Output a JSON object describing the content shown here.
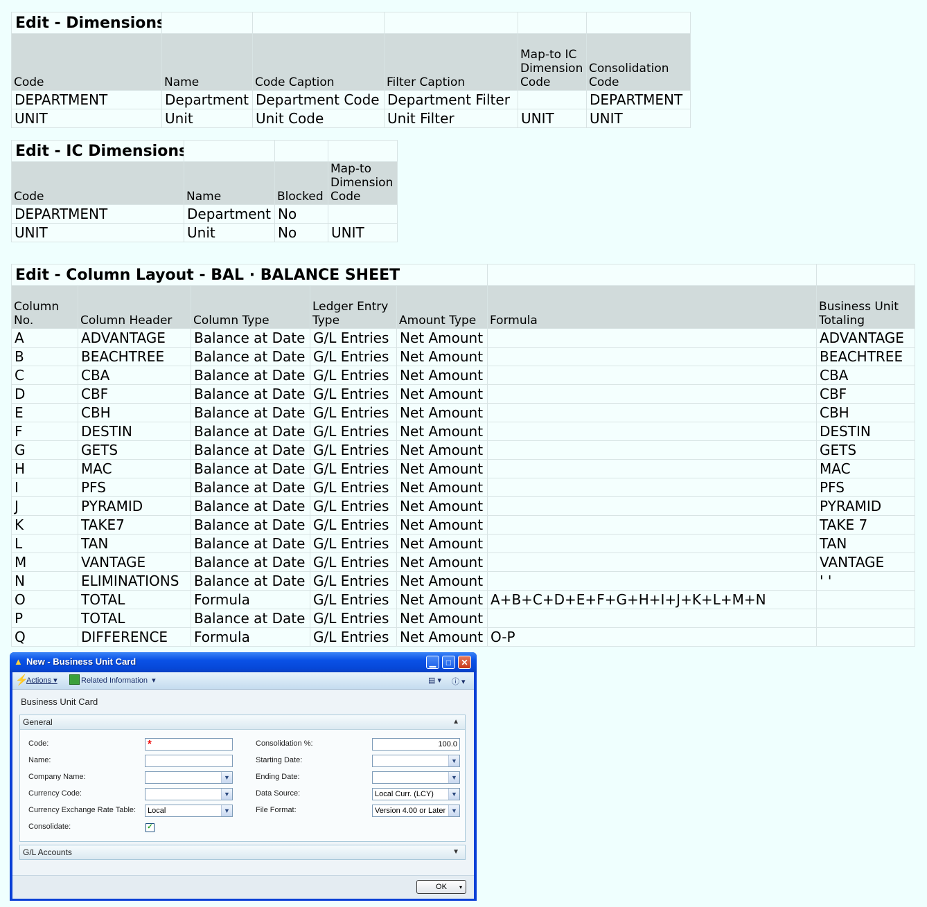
{
  "dimensions": {
    "title": "Edit - Dimensions",
    "headers": [
      "Code",
      "Name",
      "Code Caption",
      "Filter Caption",
      "Map-to IC Dimension Code",
      "Consolidation Code"
    ],
    "rows": [
      [
        "DEPARTMENT",
        "Department",
        "Department Code",
        "Department Filter",
        "",
        "DEPARTMENT"
      ],
      [
        "UNIT",
        "Unit",
        "Unit Code",
        "Unit Filter",
        "UNIT",
        "UNIT"
      ]
    ]
  },
  "ic_dimensions": {
    "title": "Edit - IC Dimensions",
    "headers": [
      "Code",
      "Name",
      "Blocked",
      "Map-to Dimension Code"
    ],
    "rows": [
      [
        "DEPARTMENT",
        "Department",
        "No",
        ""
      ],
      [
        "UNIT",
        "Unit",
        "No",
        "UNIT"
      ]
    ]
  },
  "column_layout": {
    "title": "Edit - Column Layout - BAL · BALANCE SHEET",
    "headers": [
      "Column No.",
      "Column Header",
      "Column Type",
      "Ledger Entry Type",
      "Amount Type",
      "Formula",
      "Business Unit Totaling"
    ],
    "rows": [
      [
        "A",
        "ADVANTAGE",
        "Balance at Date",
        "G/L Entries",
        "Net Amount",
        "",
        "ADVANTAGE"
      ],
      [
        "B",
        "BEACHTREE",
        "Balance at Date",
        "G/L Entries",
        "Net Amount",
        "",
        "BEACHTREE"
      ],
      [
        "C",
        "CBA",
        "Balance at Date",
        "G/L Entries",
        "Net Amount",
        "",
        "CBA"
      ],
      [
        "D",
        "CBF",
        "Balance at Date",
        "G/L Entries",
        "Net Amount",
        "",
        "CBF"
      ],
      [
        "E",
        "CBH",
        "Balance at Date",
        "G/L Entries",
        "Net Amount",
        "",
        "CBH"
      ],
      [
        "F",
        "DESTIN",
        "Balance at Date",
        "G/L Entries",
        "Net Amount",
        "",
        "DESTIN"
      ],
      [
        "G",
        "GETS",
        "Balance at Date",
        "G/L Entries",
        "Net Amount",
        "",
        "GETS"
      ],
      [
        "H",
        "MAC",
        "Balance at Date",
        "G/L Entries",
        "Net Amount",
        "",
        "MAC"
      ],
      [
        "I",
        "PFS",
        "Balance at Date",
        "G/L Entries",
        "Net Amount",
        "",
        "PFS"
      ],
      [
        "J",
        "PYRAMID",
        "Balance at Date",
        "G/L Entries",
        "Net Amount",
        "",
        "PYRAMID"
      ],
      [
        "K",
        "TAKE7",
        "Balance at Date",
        "G/L Entries",
        "Net Amount",
        "",
        "TAKE 7"
      ],
      [
        "L",
        "TAN",
        "Balance at Date",
        "G/L Entries",
        "Net Amount",
        "",
        "TAN"
      ],
      [
        "M",
        "VANTAGE",
        "Balance at Date",
        "G/L Entries",
        "Net Amount",
        "",
        "VANTAGE"
      ],
      [
        "N",
        "ELIMINATIONS",
        "Balance at Date",
        "G/L Entries",
        "Net Amount",
        "",
        "' '"
      ],
      [
        "O",
        "TOTAL",
        "Formula",
        "G/L Entries",
        "Net Amount",
        "A+B+C+D+E+F+G+H+I+J+K+L+M+N",
        ""
      ],
      [
        "P",
        "TOTAL",
        "Balance at Date",
        "G/L Entries",
        "Net Amount",
        "",
        ""
      ],
      [
        "Q",
        "DIFFERENCE",
        "Formula",
        "G/L Entries",
        "Net Amount",
        "O-P",
        ""
      ]
    ]
  },
  "window": {
    "title": "New - Business Unit Card",
    "toolbar": {
      "actions": "Actions",
      "related": "Related Information"
    },
    "page_title": "Business Unit Card",
    "general_tab": "General",
    "gl_tab": "G/L Accounts",
    "left_fields": [
      {
        "label": "Code:",
        "value": "",
        "type": "text",
        "required": true
      },
      {
        "label": "Name:",
        "value": "",
        "type": "text"
      },
      {
        "label": "Company Name:",
        "value": "",
        "type": "dropdown"
      },
      {
        "label": "Currency Code:",
        "value": "",
        "type": "dropdown"
      },
      {
        "label": "Currency Exchange Rate Table:",
        "value": "Local",
        "type": "dropdown"
      },
      {
        "label": "Consolidate:",
        "value": "✓",
        "type": "checkbox"
      }
    ],
    "right_fields": [
      {
        "label": "Consolidation %:",
        "value": "100.0",
        "type": "number"
      },
      {
        "label": "Starting Date:",
        "value": "",
        "type": "dropdown"
      },
      {
        "label": "Ending Date:",
        "value": "",
        "type": "dropdown"
      },
      {
        "label": "Data Source:",
        "value": "Local Curr. (LCY)",
        "type": "dropdown"
      },
      {
        "label": "File Format:",
        "value": "Version 4.00 or Later",
        "type": "dropdown"
      }
    ],
    "ok_label": "OK"
  }
}
